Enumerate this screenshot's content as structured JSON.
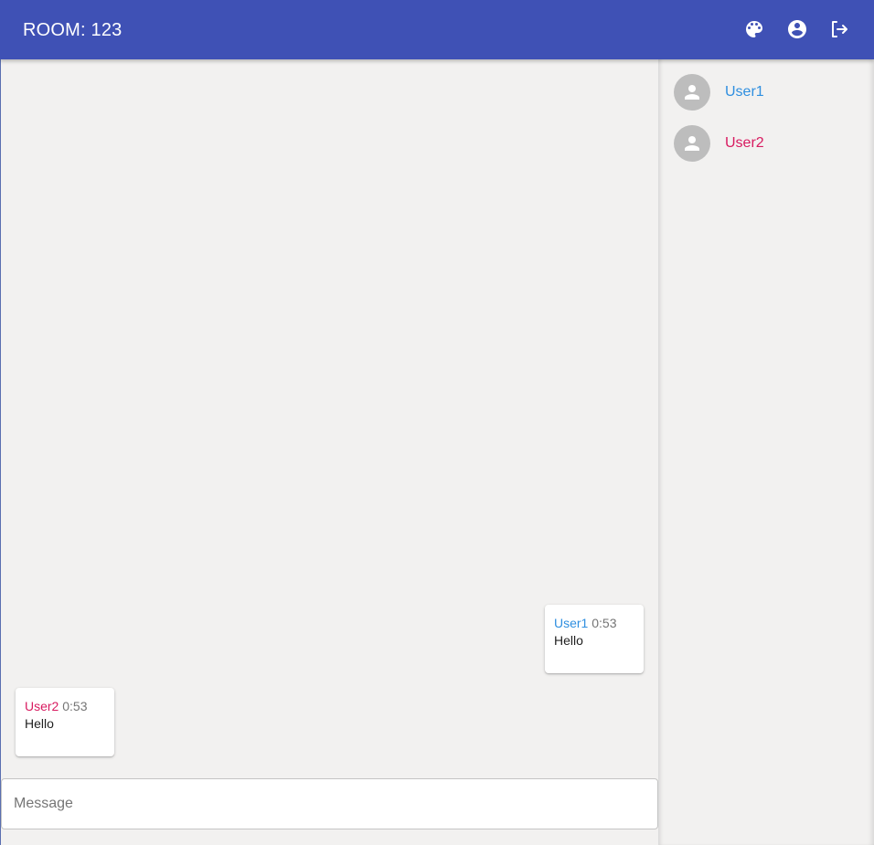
{
  "header": {
    "title": "ROOM: 123",
    "background": "#3f51b5",
    "icons": [
      "palette-icon",
      "account-circle-icon",
      "logout-icon"
    ]
  },
  "users": [
    {
      "name": "User1",
      "color": "#2f8fe0"
    },
    {
      "name": "User2",
      "color": "#d81b60"
    }
  ],
  "messages": [
    {
      "author": "User1",
      "time": "0:53",
      "text": "Hello",
      "author_color": "#2f8fe0"
    },
    {
      "author": "User2",
      "time": "0:53",
      "text": "Hello",
      "author_color": "#d81b60"
    }
  ],
  "composer": {
    "placeholder": "Message",
    "value": ""
  }
}
